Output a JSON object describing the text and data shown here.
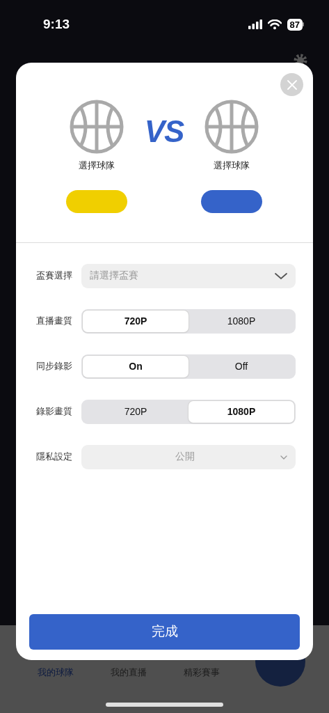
{
  "status_bar": {
    "time": "9:13",
    "battery": "87"
  },
  "modal": {
    "teams": [
      {
        "label": "選擇球隊",
        "color": "#f0cf00"
      },
      {
        "label": "選擇球隊",
        "color": "#3563c9"
      }
    ],
    "vs": "VS",
    "fields": [
      {
        "kind": "select",
        "label": "盃賽選擇",
        "placeholder": "請選擇盃賽",
        "disabled": false
      },
      {
        "kind": "segmented",
        "label": "直播畫質",
        "options": [
          {
            "label": "720P",
            "selected": true
          },
          {
            "label": "1080P",
            "selected": false
          }
        ]
      },
      {
        "kind": "segmented",
        "label": "同步錄影",
        "options": [
          {
            "label": "On",
            "selected": true
          },
          {
            "label": "Off",
            "selected": false
          }
        ]
      },
      {
        "kind": "segmented",
        "label": "錄影畫質",
        "options": [
          {
            "label": "720P",
            "selected": false
          },
          {
            "label": "1080P",
            "selected": true
          }
        ]
      },
      {
        "kind": "select",
        "label": "隱私設定",
        "value": "公開",
        "disabled": true
      }
    ],
    "done_button": "完成"
  },
  "tab_bar": {
    "tabs": [
      {
        "label": "我的球隊",
        "selected": true
      },
      {
        "label": "我的直播",
        "selected": false
      },
      {
        "label": "精彩賽事",
        "selected": false
      }
    ]
  }
}
